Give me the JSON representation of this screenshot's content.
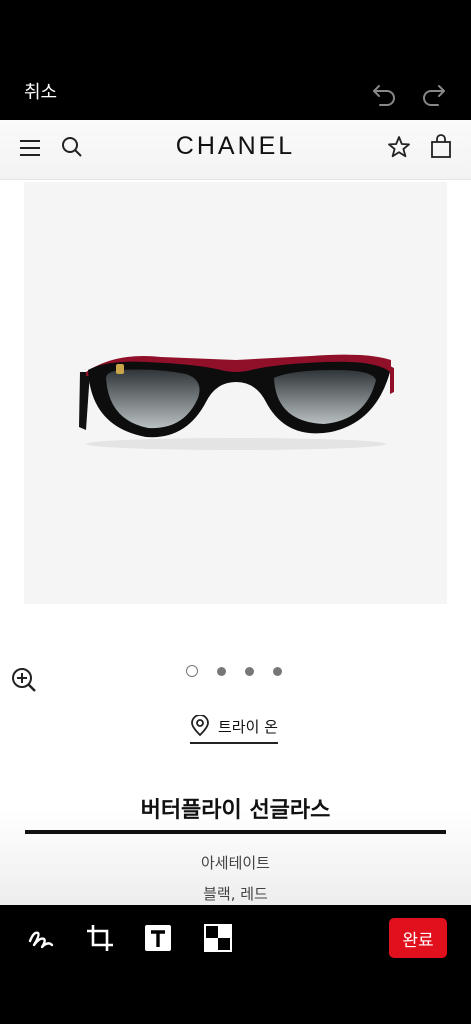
{
  "editor": {
    "cancel_label": "취소",
    "done_label": "완료",
    "tools": [
      "pen-icon",
      "crop-icon",
      "text-icon",
      "mosaic-icon"
    ]
  },
  "site": {
    "brand": "CHANEL"
  },
  "product": {
    "gallery_count": 4,
    "gallery_active": 1,
    "tryon_label": "트라이 온",
    "name": "버터플라이 선글라스",
    "material": "아세테이트",
    "color": "블랙, 레드"
  },
  "colors": {
    "accent": "#e0101c",
    "frame_red": "#b5122e"
  }
}
